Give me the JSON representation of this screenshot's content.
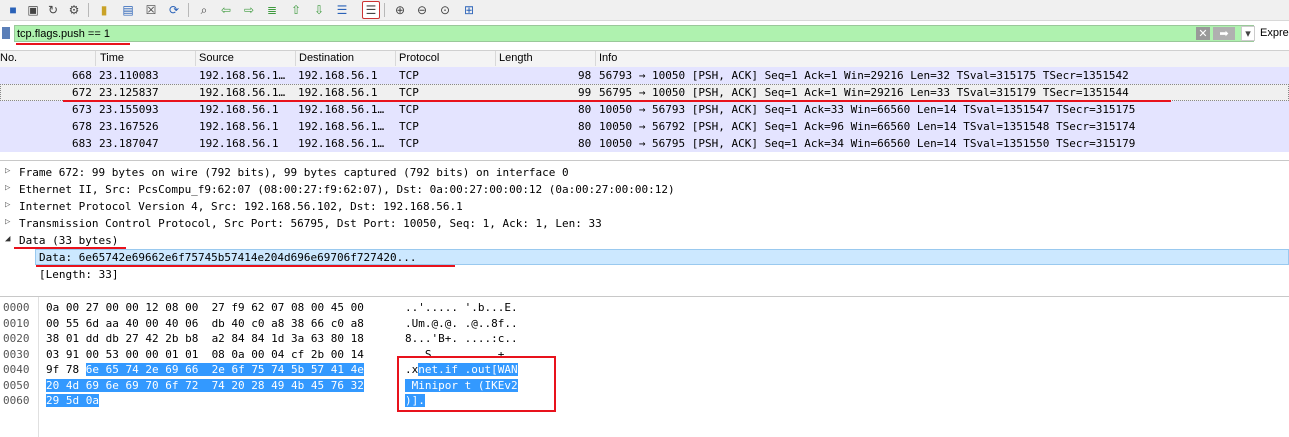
{
  "toolbar": {
    "icons": [
      "stop-capture-icon",
      "restart-capture-icon",
      "options-icon",
      "open-file-icon",
      "save-file-icon",
      "close-file-icon",
      "reload-icon",
      "find-icon",
      "go-back-icon",
      "go-forward-icon",
      "go-to-packet-icon",
      "go-first-icon",
      "go-last-icon",
      "auto-scroll-icon",
      "colorize-icon",
      "zoom-in-icon",
      "zoom-out-icon",
      "zoom-normal-icon",
      "resize-columns-icon"
    ]
  },
  "filter": {
    "value": "tcp.flags.push == 1",
    "expression_label": "Expre"
  },
  "packet_list": {
    "columns": [
      "No.",
      "Time",
      "Source",
      "Destination",
      "Protocol",
      "Length",
      "Info"
    ],
    "rows": [
      {
        "no": "668",
        "time": "23.110083",
        "source": "192.168.56.1…",
        "destination": "192.168.56.1",
        "protocol": "TCP",
        "length": "98",
        "info": "56793 → 10050 [PSH, ACK] Seq=1 Ack=1 Win=29216 Len=32 TSval=315175 TSecr=1351542"
      },
      {
        "no": "672",
        "time": "23.125837",
        "source": "192.168.56.1…",
        "destination": "192.168.56.1",
        "protocol": "TCP",
        "length": "99",
        "info": "56795 → 10050 [PSH, ACK] Seq=1 Ack=1 Win=29216 Len=33 TSval=315179 TSecr=1351544"
      },
      {
        "no": "673",
        "time": "23.155093",
        "source": "192.168.56.1",
        "destination": "192.168.56.1…",
        "protocol": "TCP",
        "length": "80",
        "info": "10050 → 56793 [PSH, ACK] Seq=1 Ack=33 Win=66560 Len=14 TSval=1351547 TSecr=315175"
      },
      {
        "no": "678",
        "time": "23.167526",
        "source": "192.168.56.1",
        "destination": "192.168.56.1…",
        "protocol": "TCP",
        "length": "80",
        "info": "10050 → 56792 [PSH, ACK] Seq=1 Ack=96 Win=66560 Len=14 TSval=1351548 TSecr=315174"
      },
      {
        "no": "683",
        "time": "23.187047",
        "source": "192.168.56.1",
        "destination": "192.168.56.1…",
        "protocol": "TCP",
        "length": "80",
        "info": "10050 → 56795 [PSH, ACK] Seq=1 Ack=34 Win=66560 Len=14 TSval=1351550 TSecr=315179"
      }
    ]
  },
  "details": {
    "frame": "Frame 672: 99 bytes on wire (792 bits), 99 bytes captured (792 bits) on interface 0",
    "ethernet": "Ethernet II, Src: PcsCompu_f9:62:07 (08:00:27:f9:62:07), Dst: 0a:00:27:00:00:12 (0a:00:27:00:00:12)",
    "ip": "Internet Protocol Version 4, Src: 192.168.56.102, Dst: 192.168.56.1",
    "tcp": "Transmission Control Protocol, Src Port: 56795, Dst Port: 10050, Seq: 1, Ack: 1, Len: 33",
    "data": "Data (33 bytes)",
    "data_value": "Data: 6e65742e69662e6f75745b57414e204d696e69706f727420...",
    "data_length": "[Length: 33]"
  },
  "bytes": {
    "offsets": [
      "0000",
      "0010",
      "0020",
      "0030",
      "0040",
      "0050",
      "0060"
    ],
    "hex": [
      {
        "pre": "0a 00 27 00 00 12 08 00  27 f9 62 07 08 00 45 00",
        "hl": ""
      },
      {
        "pre": "00 55 6d aa 40 00 40 06  db 40 c0 a8 38 66 c0 a8",
        "hl": ""
      },
      {
        "pre": "38 01 dd db 27 42 2b b8  a2 84 84 1d 3a 63 80 18",
        "hl": ""
      },
      {
        "pre": "03 91 00 53 00 00 01 01  08 0a 00 04 cf 2b 00 14",
        "hl": ""
      },
      {
        "pre": "9f 78 ",
        "hl": "6e 65 74 2e 69 66  2e 6f 75 74 5b 57 41 4e"
      },
      {
        "pre": "",
        "hl": "20 4d 69 6e 69 70 6f 72  74 20 28 49 4b 45 76 32"
      },
      {
        "pre": "",
        "hl": "29 5d 0a"
      }
    ],
    "ascii": [
      {
        "pre": "..'..... '.b...E.",
        "hl": ""
      },
      {
        "pre": ".Um.@.@. .@..8f..",
        "hl": ""
      },
      {
        "pre": "8...'B+. ....:c..",
        "hl": ""
      },
      {
        "pre": "...S.... .....+..",
        "hl": ""
      },
      {
        "pre": ".x",
        "hl": "net.if .out[WAN"
      },
      {
        "pre": "",
        "hl": " Minipor t (IKEv2"
      },
      {
        "pre": "",
        "hl": ")]."
      }
    ]
  }
}
